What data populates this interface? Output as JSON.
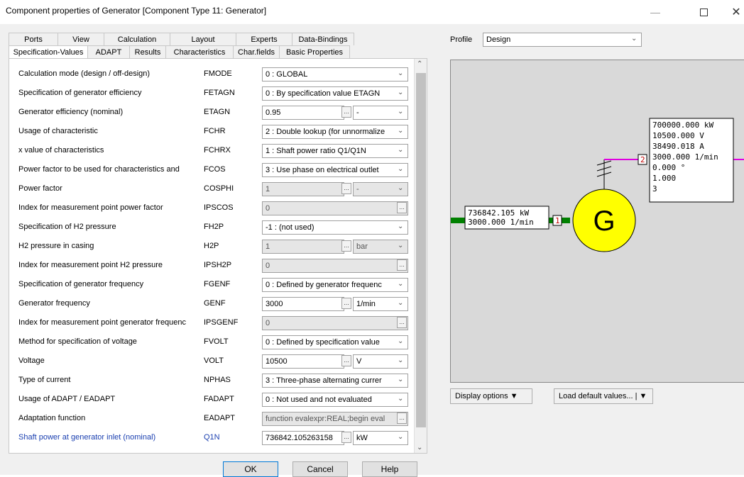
{
  "window": {
    "title": "Component properties of Generator  [Component Type 11: Generator]"
  },
  "tabs_row1": [
    "Ports",
    "View",
    "Calculation",
    "Layout",
    "Experts",
    "Data-Bindings"
  ],
  "tabs_row2": [
    "Specification-Values",
    "ADAPT",
    "Results",
    "Characteristics",
    "Char.fields",
    "Basic Properties"
  ],
  "active_tab": "Specification-Values",
  "rows": [
    {
      "label": "Calculation mode (design / off-design)",
      "code": "FMODE",
      "type": "combo",
      "value": "0 : GLOBAL"
    },
    {
      "label": "Specification of generator efficiency",
      "code": "FETAGN",
      "type": "combo",
      "value": "0 : By specification value ETAGN"
    },
    {
      "label": "Generator efficiency (nominal)",
      "code": "ETAGN",
      "type": "value_unit",
      "value": "0.95",
      "unit": "-"
    },
    {
      "label": "Usage of characteristic",
      "code": "FCHR",
      "type": "combo",
      "value": "2 : Double lookup (for unnormalize"
    },
    {
      "label": "x value of characteristics",
      "code": "FCHRX",
      "type": "combo",
      "value": "1 : Shaft power ratio Q1/Q1N"
    },
    {
      "label": "Power factor to be used for characteristics and",
      "code": "FCOS",
      "type": "combo",
      "value": "3 : Use phase on electrical outlet"
    },
    {
      "label": "Power factor",
      "code": "COSPHI",
      "type": "value_unit_disabled",
      "value": "1",
      "unit": "-"
    },
    {
      "label": "Index for measurement point power factor",
      "code": "IPSCOS",
      "type": "index_disabled",
      "value": "0"
    },
    {
      "label": "Specification of H2 pressure",
      "code": "FH2P",
      "type": "combo",
      "value": "-1 : (not used)"
    },
    {
      "label": "H2 pressure in casing",
      "code": "H2P",
      "type": "value_unit_disabled",
      "value": "1",
      "unit": "bar"
    },
    {
      "label": "Index for measurement point H2 pressure",
      "code": "IPSH2P",
      "type": "index_disabled",
      "value": "0"
    },
    {
      "label": "Specification of generator frequency",
      "code": "FGENF",
      "type": "combo",
      "value": "0 : Defined by generator frequenc"
    },
    {
      "label": "Generator frequency",
      "code": "GENF",
      "type": "value_unit",
      "value": "3000",
      "unit": "1/min"
    },
    {
      "label": "Index for measurement point generator frequenc",
      "code": "IPSGENF",
      "type": "index_disabled",
      "value": "0"
    },
    {
      "label": "Method for specification of voltage",
      "code": "FVOLT",
      "type": "combo",
      "value": "0 : Defined by specification value"
    },
    {
      "label": "Voltage",
      "code": "VOLT",
      "type": "value_unit",
      "value": "10500",
      "unit": "V"
    },
    {
      "label": "Type of current",
      "code": "NPHAS",
      "type": "combo",
      "value": "3 : Three-phase alternating currer"
    },
    {
      "label": "Usage of ADAPT / EADAPT",
      "code": "FADAPT",
      "type": "combo",
      "value": "0 : Not used and not evaluated"
    },
    {
      "label": "Adaptation function",
      "code": "EADAPT",
      "type": "text_btn",
      "value": "function evalexpr:REAL;begin eval"
    },
    {
      "label": "Shaft power at generator inlet (nominal)",
      "code": "Q1N",
      "type": "value_unit",
      "value": "736842.105263158",
      "unit": "kW",
      "blue": true
    }
  ],
  "buttons": {
    "ok": "OK",
    "cancel": "Cancel",
    "help": "Help"
  },
  "profile": {
    "label": "Profile",
    "value": "Design"
  },
  "diagram": {
    "generator_label": "G",
    "port_in": "1",
    "port_out": "2",
    "inlet_lines": [
      "736842.105 kW",
      "3000.000 1/min"
    ],
    "outlet_lines": [
      "700000.000 kW",
      "10500.000 V",
      "38490.018 A",
      "3000.000 1/min",
      "0.000 °",
      "1.000",
      "3"
    ]
  },
  "display_options": "Display options",
  "load_defaults": "Load default values...",
  "colors": {
    "generator_fill": "#ffff00",
    "shaft_line": "#008000",
    "electric_line": "#e000e0",
    "blue_text": "#1a3fb0"
  }
}
